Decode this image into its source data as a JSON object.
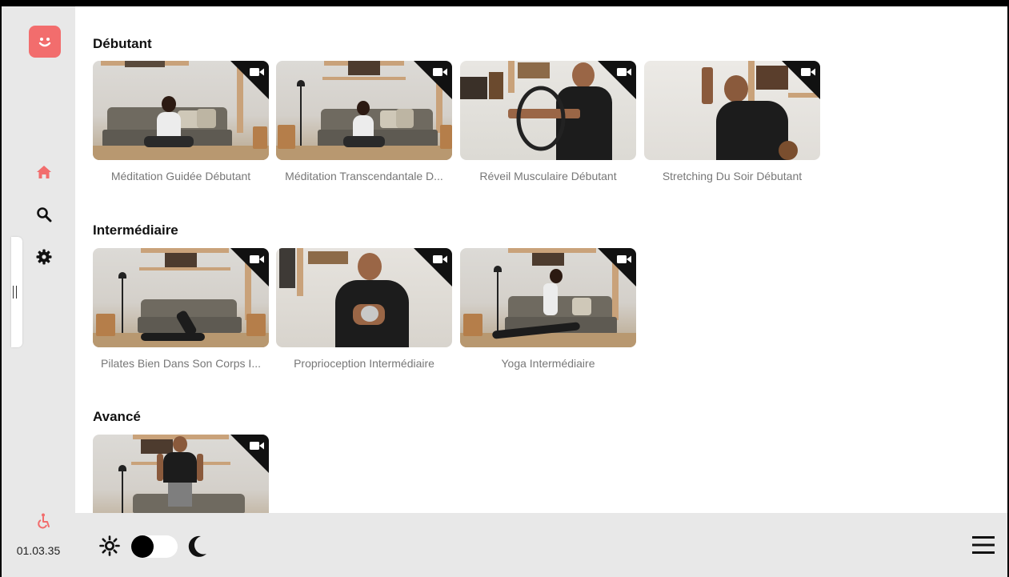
{
  "sidebar": {
    "clock": "01.03.35",
    "accent_color": "#f26d6d"
  },
  "sections": [
    {
      "title": "Débutant",
      "items": [
        {
          "label": "Méditation Guidée Débutant"
        },
        {
          "label": "Méditation Transcendantale D..."
        },
        {
          "label": "Réveil Musculaire Débutant"
        },
        {
          "label": "Stretching Du Soir Débutant"
        }
      ]
    },
    {
      "title": "Intermédiaire",
      "items": [
        {
          "label": "Pilates Bien Dans Son Corps I..."
        },
        {
          "label": "Proprioception Intermédiaire"
        },
        {
          "label": "Yoga Intermédiaire"
        }
      ]
    },
    {
      "title": "Avancé",
      "items": [
        {
          "label": ""
        }
      ]
    }
  ],
  "icons": {
    "logo": "smiley-logo-icon",
    "home": "home-icon",
    "search": "search-icon",
    "settings": "gear-icon",
    "accessibility": "wheelchair-icon",
    "video": "video-camera-icon",
    "light": "sun-icon",
    "dark": "moon-icon",
    "menu": "hamburger-menu-icon"
  }
}
